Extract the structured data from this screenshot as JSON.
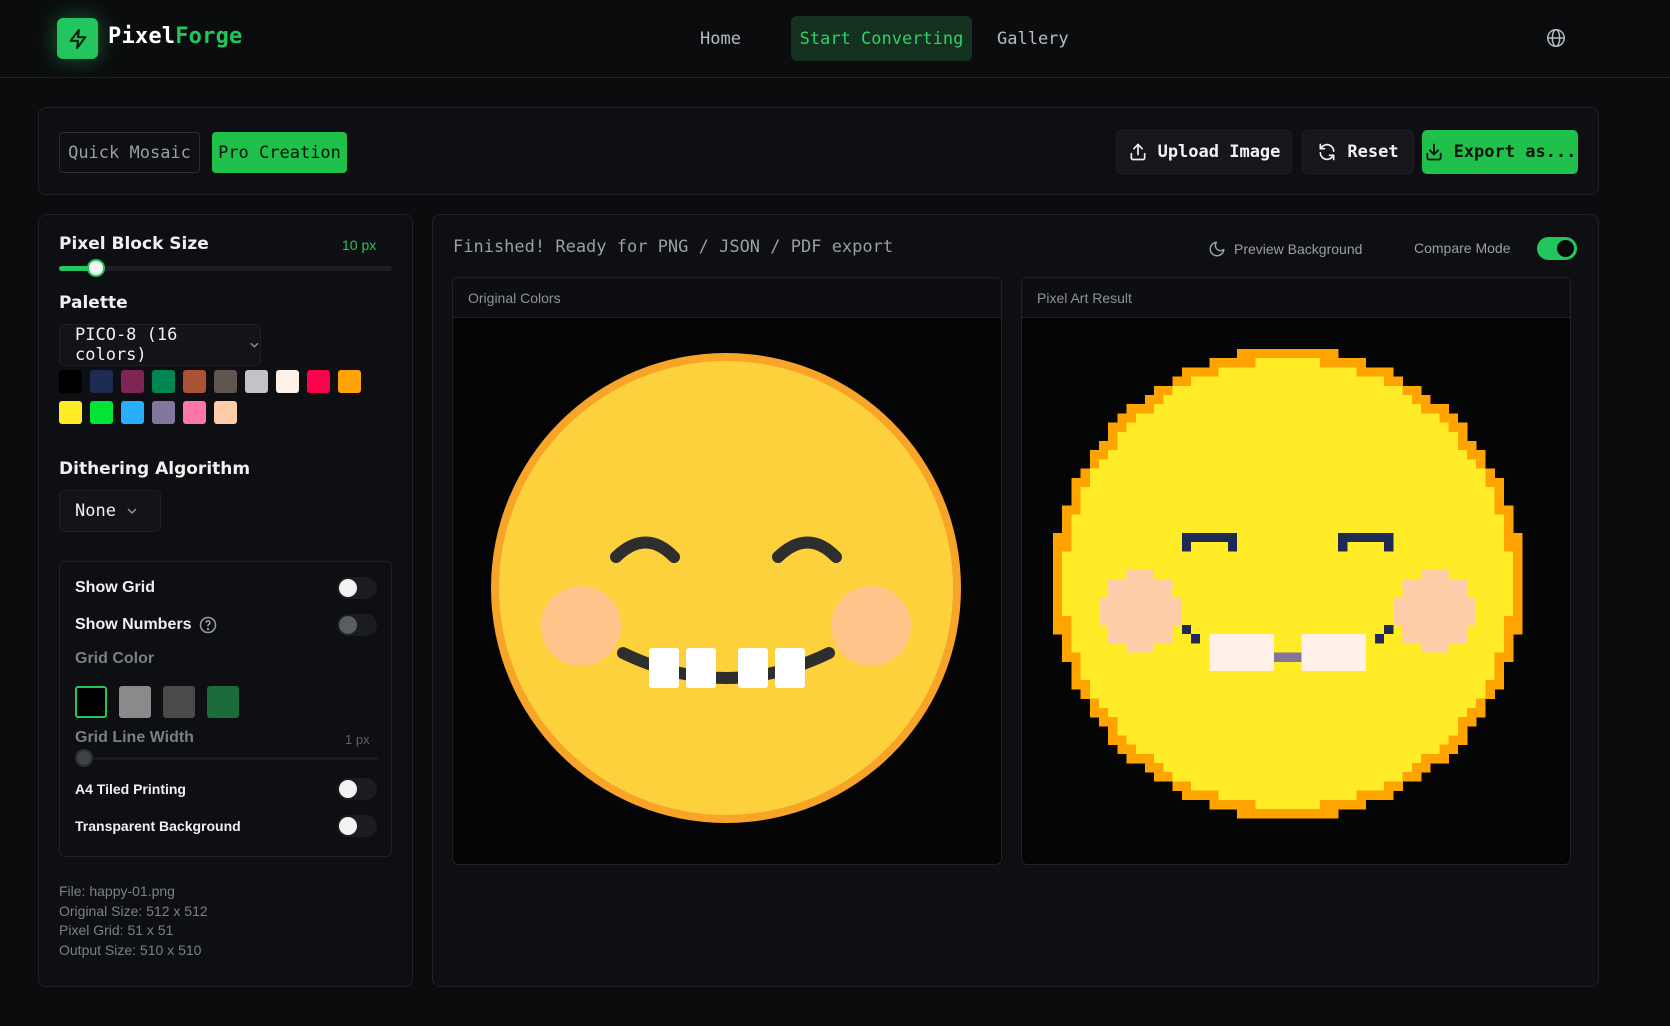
{
  "brand": {
    "part1": "Pixel",
    "part2": "Forge"
  },
  "nav": {
    "home": "Home",
    "start": "Start Converting",
    "gallery": "Gallery"
  },
  "modes": {
    "quick": "Quick Mosaic",
    "pro": "Pro Creation"
  },
  "actions": {
    "upload": "Upload Image",
    "reset": "Reset",
    "export": "Export as..."
  },
  "settings": {
    "block_size_label": "Pixel Block Size",
    "block_size_value": "10 px",
    "block_size_fraction": 0.11,
    "palette_label": "Palette",
    "palette_selected": "PICO-8 (16 colors)",
    "palette_colors": [
      "#000000",
      "#1d2b53",
      "#7e2553",
      "#008751",
      "#ab5236",
      "#5f574f",
      "#c2c3c7",
      "#fff1e8",
      "#ff004d",
      "#ffa300",
      "#ffec27",
      "#00e436",
      "#29adff",
      "#83769c",
      "#ff77a8",
      "#ffccaa"
    ],
    "dither_label": "Dithering Algorithm",
    "dither_selected": "None",
    "show_grid": "Show Grid",
    "show_numbers": "Show Numbers",
    "grid_color": "Grid Color",
    "grid_colors": [
      "#000000",
      "#8a8a8a",
      "#4a4a4a",
      "#1d6b3a"
    ],
    "grid_line_width": "Grid Line Width",
    "grid_line_width_value": "1 px",
    "a4_tiled": "A4 Tiled Printing",
    "transparent_bg": "Transparent Background"
  },
  "file_info": {
    "file": "File: happy-01.png",
    "original_size": "Original Size: 512 x 512",
    "pixel_grid": "Pixel Grid: 51 x 51",
    "output_size": "Output Size: 510 x 510"
  },
  "preview": {
    "status": "Finished! Ready for PNG / JSON / PDF export",
    "preview_bg": "Preview Background",
    "compare_mode": "Compare Mode",
    "original_title": "Original Colors",
    "result_title": "Pixel Art Result"
  }
}
